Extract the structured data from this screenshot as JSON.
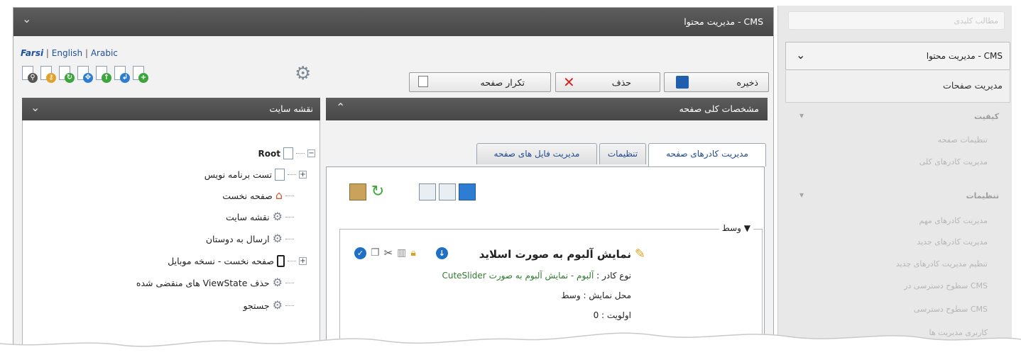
{
  "sidebar": {
    "top_field": "مطالب کلیدی",
    "cms_label": "مدیریت محتوا - CMS",
    "pages_label": "مدیریت صفحات",
    "faded_items": [
      {
        "label": "کیفیت",
        "type": "header"
      },
      {
        "label": "تنظیمات صفحه",
        "type": "item"
      },
      {
        "label": "مدیریت کادرهای کلی",
        "type": "item"
      },
      {
        "label": "تنظیمات",
        "type": "header"
      },
      {
        "label": "مدیریت کادرهای مهم",
        "type": "item"
      },
      {
        "label": "مدیریت کادرهای جدید",
        "type": "item"
      },
      {
        "label": "تنظیم مدیریت کادرهای جدید",
        "type": "item"
      },
      {
        "label": "سطوح دسترسی در CMS",
        "type": "item"
      },
      {
        "label": "سطوح دسترسی CMS",
        "type": "item"
      },
      {
        "label": "کاربری مدیریت ها",
        "type": "item"
      }
    ]
  },
  "main": {
    "title": "مدیریت محتوا - CMS",
    "languages": {
      "active": "Farsi",
      "others": [
        "English",
        "Arabic"
      ],
      "separator": "|"
    },
    "toolbar_icons": [
      "search-file-icon",
      "key-file-icon",
      "refresh-file-icon",
      "move-file-icon",
      "upload-file-icon",
      "import-file-icon",
      "add-file-icon"
    ],
    "buttons": {
      "save": "ذخیره",
      "delete": "حذف",
      "duplicate": "تکرار صفحه"
    }
  },
  "sitemap": {
    "title": "نقشه سایت",
    "root": "Root",
    "items": [
      {
        "label": "تست برنامه نویس",
        "icon": "page-icon",
        "expandable": true
      },
      {
        "label": "صفحه نخست",
        "icon": "home-icon",
        "expandable": false
      },
      {
        "label": "نقشه سایت",
        "icon": "gear-icon",
        "expandable": false
      },
      {
        "label": "ارسال به دوستان",
        "icon": "gear-icon",
        "expandable": false
      },
      {
        "label": "صفحه نخست - نسخه موبایل",
        "icon": "mobile-icon",
        "expandable": true
      },
      {
        "label": "حذف ViewState های منقضی شده",
        "icon": "gear-icon",
        "expandable": false
      },
      {
        "label": "جستجو",
        "icon": "gear-icon",
        "expandable": false
      }
    ]
  },
  "content": {
    "panel_title": "مشخصات کلی صفحه",
    "tabs": [
      {
        "label": "مدیریت کادرهای صفحه",
        "active": true
      },
      {
        "label": "تنظیمات",
        "active": false
      },
      {
        "label": "مدیریت فایل های صفحه",
        "active": false
      }
    ],
    "tool_icons": [
      "add-frame-icon",
      "search-frame-icon",
      "new-frame-icon",
      "refresh-icon",
      "paste-icon"
    ],
    "zone_legend": "وسط",
    "frame": {
      "title": "نمایش آلبوم به صورت اسلاید",
      "type_label": "نوع کادر :",
      "type_value": "آلبوم - نمایش آلبوم به صورت CuteSlider",
      "position_label": "محل نمایش :",
      "position_value": "وسط",
      "priority_label": "اولویت :",
      "priority_value": "0"
    }
  },
  "colors": {
    "header_dark": "#4f4f4f",
    "link_blue": "#1e4f9c",
    "green_text": "#2f7d2f",
    "delete_red": "#d9251d"
  }
}
